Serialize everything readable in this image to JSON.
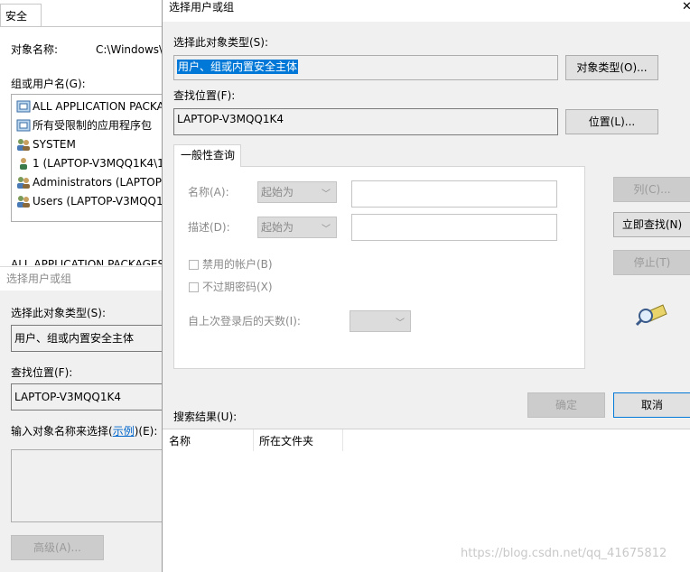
{
  "security_window": {
    "tab": "安全",
    "object_name_label": "对象名称:",
    "object_name_value": "C:\\Windows\\",
    "group_label": "组或用户名(G):",
    "users": [
      {
        "name": "ALL APPLICATION PACKA",
        "icon": "package-icon"
      },
      {
        "name": "所有受限制的应用程序包",
        "icon": "package-icon"
      },
      {
        "name": "SYSTEM",
        "icon": "group-icon"
      },
      {
        "name": "1 (LAPTOP-V3MQQ1K4\\1",
        "icon": "user-icon"
      },
      {
        "name": "Administrators (LAPTOP-",
        "icon": "group-icon"
      },
      {
        "name": "Users (LAPTOP-V3MQQ1",
        "icon": "group-icon"
      }
    ],
    "cut_text": "ALL APPLICATION PACKAGES"
  },
  "basic_dialog": {
    "title": "选择用户或组",
    "type_label": "选择此对象类型(S):",
    "type_value": "用户、组或内置安全主体",
    "location_label": "查找位置(F):",
    "location_value": "LAPTOP-V3MQQ1K4",
    "enter_label_pre": "输入对象名称来选择(",
    "enter_label_link": "示例",
    "enter_label_post": ")(E):",
    "advanced_button": "高级(A)..."
  },
  "advanced_dialog": {
    "title": "选择用户或组",
    "type_label": "选择此对象类型(S):",
    "type_value": "用户、组或内置安全主体",
    "object_types_button": "对象类型(O)...",
    "location_label": "查找位置(F):",
    "location_value": "LAPTOP-V3MQQ1K4",
    "locations_button": "位置(L)...",
    "tab_general": "一般性查询",
    "name_label": "名称(A):",
    "name_combo": "起始为",
    "desc_label": "描述(D):",
    "desc_combo": "起始为",
    "disabled_accounts": "禁用的帐户(B)",
    "non_expiring": "不过期密码(X)",
    "days_label": "自上次登录后的天数(I):",
    "columns_button": "列(C)...",
    "find_now_button": "立即查找(N)",
    "stop_button": "停止(T)",
    "ok_button": "确定",
    "cancel_button": "取消",
    "results_label": "搜索结果(U):",
    "col_name": "名称",
    "col_folder": "所在文件夹"
  },
  "watermark": "https://blog.csdn.net/qq_41675812"
}
